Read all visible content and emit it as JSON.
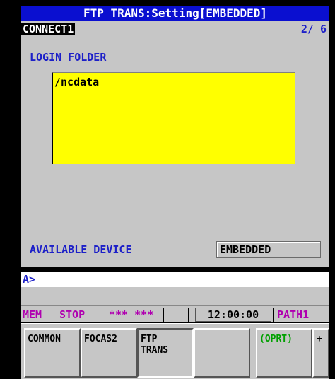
{
  "screen": {
    "title": "FTP TRANS:Setting[EMBEDDED]",
    "connection": "CONNECT1",
    "page_counter": "2/ 6"
  },
  "login_folder": {
    "label": "LOGIN FOLDER",
    "value": "/ncdata"
  },
  "available_device": {
    "label": "AVAILABLE DEVICE",
    "value": "EMBEDDED"
  },
  "input_line": {
    "prompt": "A>"
  },
  "status": {
    "mode": "MEM",
    "state": "STOP",
    "alarm": "*** ***",
    "time": "12:00:00",
    "path": "PATH1"
  },
  "softkeys": {
    "common": "COMMON",
    "focas2": "FOCAS2",
    "ftp_trans": "FTP\nTRANS",
    "empty": "",
    "oprt": "(OPRT)",
    "plus": "+"
  },
  "colors": {
    "title_bg": "#0a0fd0",
    "panel_bg": "#c6c6c6",
    "folder_bg": "#ffff00",
    "label_blue": "#1c1fc8",
    "status_magenta": "#b000b0",
    "oprt_green": "#00a000"
  }
}
